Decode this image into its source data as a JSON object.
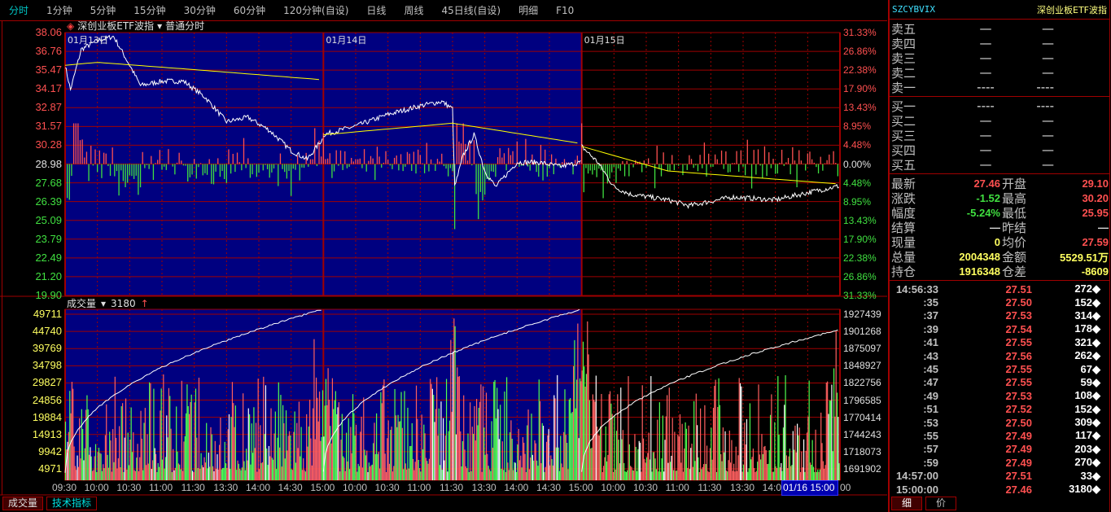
{
  "top_tabs": [
    "分时",
    "1分钟",
    "5分钟",
    "15分钟",
    "30分钟",
    "60分钟",
    "120分钟(自设)",
    "日线",
    "周线",
    "45日线(自设)",
    "明细",
    "F10"
  ],
  "chart_title": {
    "name": "深创业板ETF波指",
    "mode": "普通分时"
  },
  "volume_header": {
    "label": "成交量",
    "value": "3180"
  },
  "day_labels": [
    "01月13日",
    "01月14日",
    "01月15日"
  ],
  "price_axis": [
    "38.06",
    "36.76",
    "35.47",
    "34.17",
    "32.87",
    "31.57",
    "30.28",
    "28.98",
    "27.68",
    "26.39",
    "25.09",
    "23.79",
    "22.49",
    "21.20",
    "19.90"
  ],
  "pct_axis": [
    "31.33%",
    "26.86%",
    "22.38%",
    "17.90%",
    "13.43%",
    "8.95%",
    "4.48%",
    "0.00%",
    "4.48%",
    "8.95%",
    "13.43%",
    "17.90%",
    "22.38%",
    "26.86%",
    "31.33%"
  ],
  "vol_axis_left": [
    "49711",
    "44740",
    "39769",
    "34798",
    "29827",
    "24856",
    "19884",
    "14913",
    "9942",
    "4971"
  ],
  "vol_axis_right": [
    "1927439",
    "1901268",
    "1875097",
    "1848927",
    "1822756",
    "1796585",
    "1770414",
    "1744243",
    "1718073",
    "1691902"
  ],
  "time_axis": [
    "09:30",
    "10:00",
    "10:30",
    "11:00",
    "11:30",
    "13:30",
    "14:00",
    "14:30",
    "15:00",
    "10:00",
    "10:30",
    "11:00",
    "11:30",
    "13:30",
    "14:00",
    "14:30",
    "15:00",
    "10:00",
    "10:30",
    "11:00",
    "11:30",
    "13:30",
    "14:0",
    "01/16 15:00",
    "00"
  ],
  "bottom_tabs": [
    "成交量",
    "技术指标"
  ],
  "colors": {
    "up": "#ff5050",
    "down": "#40e040",
    "grid": "#a00000",
    "blue_bg": "#000080",
    "avg": "#ffff00"
  },
  "chart_data": {
    "type": "line",
    "prev_close": 28.98,
    "ylim": [
      19.9,
      38.06
    ],
    "minutes_total": 720,
    "price": [
      [
        0,
        35.8
      ],
      [
        5,
        34.1
      ],
      [
        15,
        36.9
      ],
      [
        30,
        37.5
      ],
      [
        45,
        37.8
      ],
      [
        60,
        35.8
      ],
      [
        70,
        34.4
      ],
      [
        90,
        34.7
      ],
      [
        110,
        34.7
      ],
      [
        130,
        33.6
      ],
      [
        150,
        31.9
      ],
      [
        170,
        32.2
      ],
      [
        190,
        31.3
      ],
      [
        210,
        29.9
      ],
      [
        225,
        29.3
      ],
      [
        239,
        30.7
      ],
      [
        240,
        31.0
      ],
      [
        270,
        31.6
      ],
      [
        300,
        32.4
      ],
      [
        330,
        33.0
      ],
      [
        350,
        33.3
      ],
      [
        360,
        32.8
      ],
      [
        362,
        27.4
      ],
      [
        370,
        29.6
      ],
      [
        380,
        31.0
      ],
      [
        390,
        28.5
      ],
      [
        400,
        27.4
      ],
      [
        420,
        29.1
      ],
      [
        440,
        29.1
      ],
      [
        460,
        28.8
      ],
      [
        479,
        29.1
      ],
      [
        480,
        30.2
      ],
      [
        495,
        29.1
      ],
      [
        510,
        27.4
      ],
      [
        525,
        26.9
      ],
      [
        560,
        26.5
      ],
      [
        580,
        26.1
      ],
      [
        620,
        26.7
      ],
      [
        660,
        26.5
      ],
      [
        690,
        27.0
      ],
      [
        719,
        27.46
      ]
    ],
    "avg": [
      [
        0,
        35.8
      ],
      [
        30,
        36.0
      ],
      [
        120,
        35.5
      ],
      [
        239,
        34.8
      ],
      [
        240,
        31.0
      ],
      [
        360,
        31.8
      ],
      [
        479,
        30.4
      ],
      [
        480,
        30.2
      ],
      [
        560,
        28.5
      ],
      [
        719,
        27.6
      ]
    ],
    "cum_volume_range": [
      1691902,
      1927439
    ]
  },
  "right_panel": {
    "code": "SZCYBVIX",
    "name": "深创业板ETF波指",
    "asks": [
      {
        "label": "卖五",
        "p": "—",
        "v": "—"
      },
      {
        "label": "卖四",
        "p": "—",
        "v": "—"
      },
      {
        "label": "卖三",
        "p": "—",
        "v": "—"
      },
      {
        "label": "卖二",
        "p": "—",
        "v": "—"
      },
      {
        "label": "卖一",
        "p": "----",
        "v": "----"
      }
    ],
    "bids": [
      {
        "label": "买一",
        "p": "----",
        "v": "----"
      },
      {
        "label": "买二",
        "p": "—",
        "v": "—"
      },
      {
        "label": "买三",
        "p": "—",
        "v": "—"
      },
      {
        "label": "买四",
        "p": "—",
        "v": "—"
      },
      {
        "label": "买五",
        "p": "—",
        "v": "—"
      }
    ],
    "stats": [
      {
        "k": "最新",
        "v": "27.46",
        "c": "red",
        "k2": "开盘",
        "v2": "29.10",
        "c2": "red"
      },
      {
        "k": "涨跌",
        "v": "-1.52",
        "c": "green",
        "k2": "最高",
        "v2": "30.20",
        "c2": "red"
      },
      {
        "k": "幅度",
        "v": "-5.24%",
        "c": "green",
        "k2": "最低",
        "v2": "25.95",
        "c2": "red"
      },
      {
        "k": "结算",
        "v": "—",
        "c": "wht",
        "k2": "昨结",
        "v2": "—",
        "c2": "wht"
      },
      {
        "k": "现量",
        "v": "0",
        "c": "yel",
        "k2": "均价",
        "v2": "27.59",
        "c2": "red"
      },
      {
        "k": "总量",
        "v": "2004348",
        "c": "yel",
        "k2": "金额",
        "v2": "5529.51万",
        "c2": "yel"
      },
      {
        "k": "持仓",
        "v": "1916348",
        "c": "yel",
        "k2": "仓差",
        "v2": "-8609",
        "c2": "yel"
      }
    ],
    "ticks": [
      [
        "14:56:33",
        "27.51",
        "272◆"
      ],
      [
        ":35",
        "27.50",
        "152◆"
      ],
      [
        ":37",
        "27.53",
        "314◆"
      ],
      [
        ":39",
        "27.54",
        "178◆"
      ],
      [
        ":41",
        "27.55",
        "321◆"
      ],
      [
        ":43",
        "27.56",
        "262◆"
      ],
      [
        ":45",
        "27.55",
        "67◆"
      ],
      [
        ":47",
        "27.55",
        "59◆"
      ],
      [
        ":49",
        "27.53",
        "108◆"
      ],
      [
        ":51",
        "27.52",
        "152◆"
      ],
      [
        ":53",
        "27.50",
        "309◆"
      ],
      [
        ":55",
        "27.49",
        "117◆"
      ],
      [
        ":57",
        "27.49",
        "203◆"
      ],
      [
        ":59",
        "27.49",
        "270◆"
      ],
      [
        "14:57:00",
        "27.51",
        "33◆"
      ],
      [
        "15:00:00",
        "27.46",
        "3180◆"
      ]
    ],
    "tabs": [
      "细",
      "价"
    ]
  }
}
